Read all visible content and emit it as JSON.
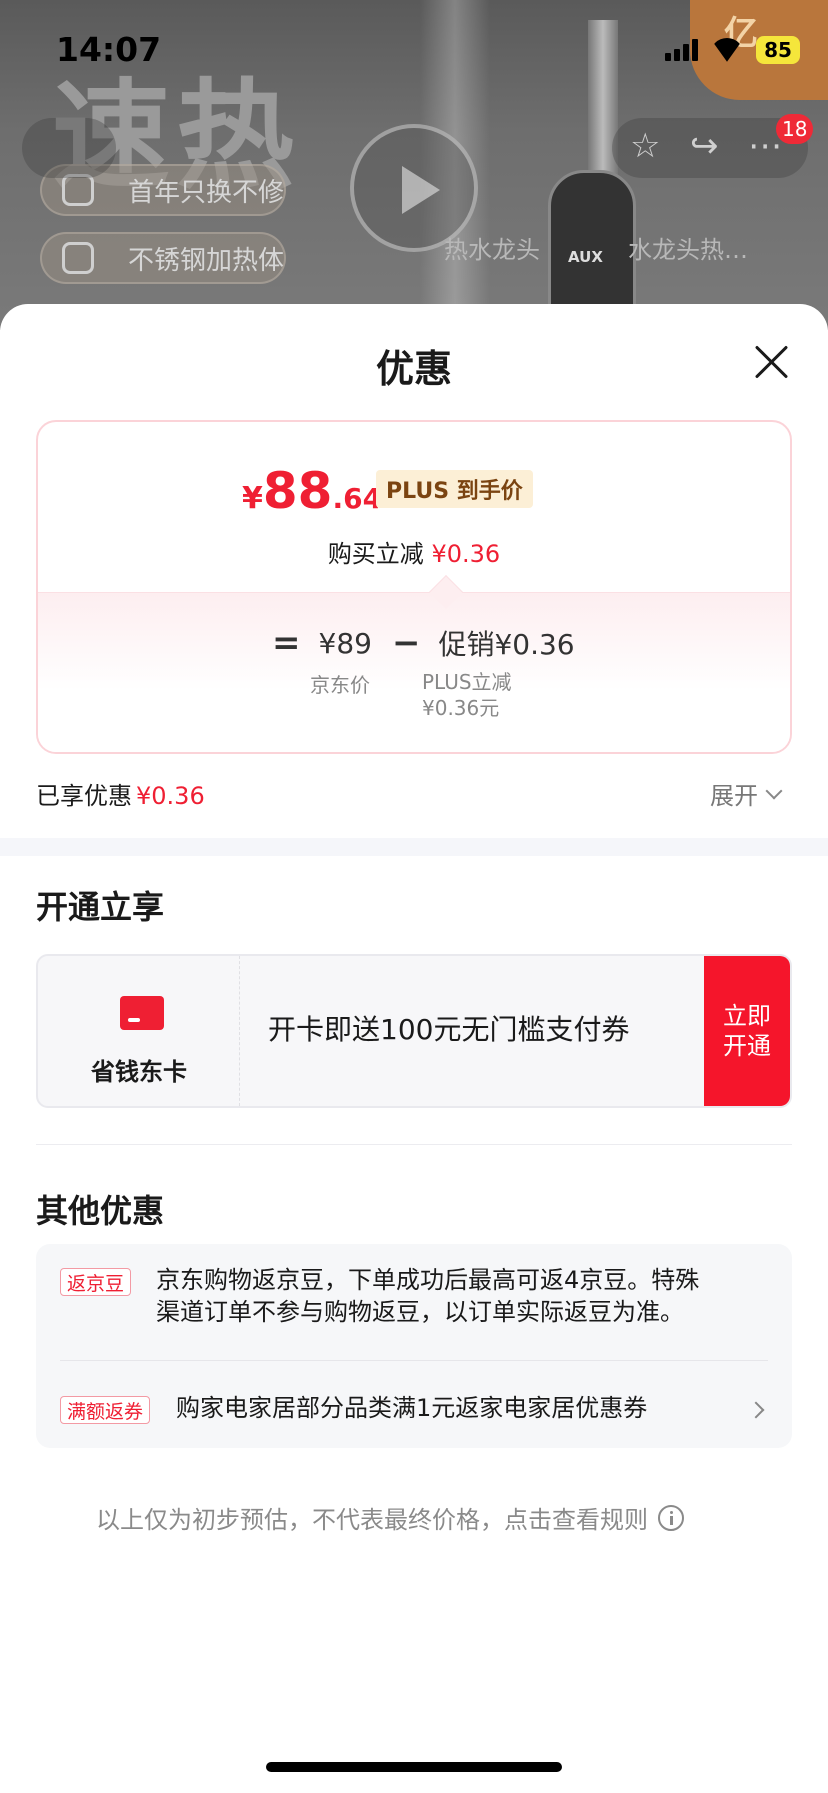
{
  "status": {
    "time": "14:07",
    "battery": "85"
  },
  "background": {
    "big_text": "速热",
    "pill1": "首年只换不修",
    "pill2": "不锈钢加热体",
    "caption_left": "热水龙头",
    "caption_right": "水龙头热…",
    "brand": "AUX",
    "logo_text": "亿",
    "cart_badge": "18"
  },
  "sheet": {
    "title": "优惠",
    "price": {
      "currency": "¥",
      "integer": "88",
      "decimal": ".64",
      "tag": "PLUS 到手价"
    },
    "buy_reduce_label": "购买立减",
    "buy_reduce_value": "¥0.36",
    "breakdown": {
      "equals": "=",
      "jd_price": "¥89",
      "minus": "−",
      "promo": "促销¥0.36",
      "jd_price_label": "京东价",
      "plus_line1": "PLUS立减",
      "plus_line2": "¥0.36元"
    },
    "enjoyed_label": "已享优惠",
    "enjoyed_value": "¥0.36",
    "expand_label": "展开"
  },
  "open_section": {
    "title": "开通立享",
    "card_name": "省钱东卡",
    "card_desc": "开卡即送100元无门槛支付券",
    "button_line1": "立即",
    "button_line2": "开通"
  },
  "other_section": {
    "title": "其他优惠",
    "items": [
      {
        "tag": "返京豆",
        "line1": "京东购物返京豆，下单成功后最高可返4京豆。特殊",
        "line2": "渠道订单不参与购物返豆，以订单实际返豆为准。"
      },
      {
        "tag": "满额返券",
        "line1": "购家电家居部分品类满1元返家电家居优惠券"
      }
    ]
  },
  "footer_note": "以上仅为初步预估，不代表最终价格，点击查看规则",
  "colors": {
    "accent": "#ef1f33",
    "plus_tag_bg": "#fcefd6",
    "plus_tag_text": "#7b4411"
  }
}
